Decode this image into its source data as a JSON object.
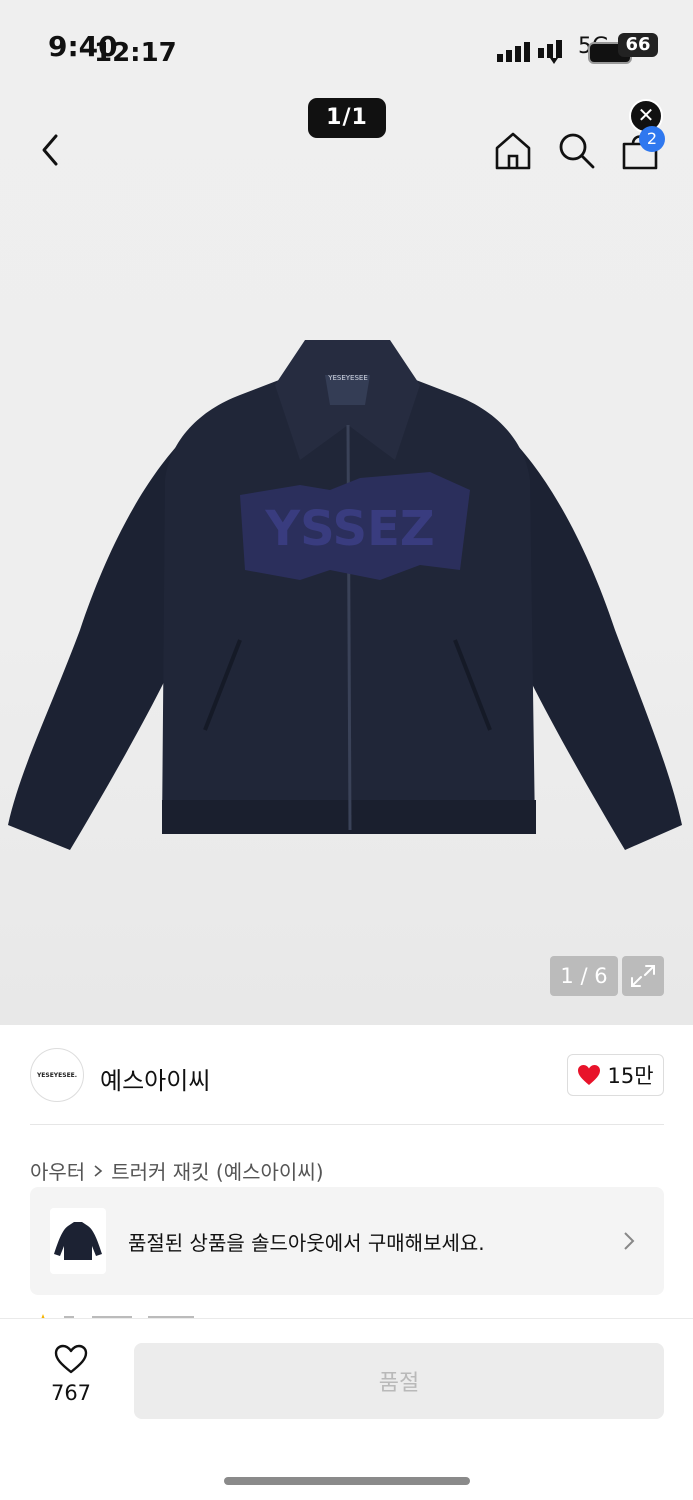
{
  "status_bar": {
    "time_primary": "9:40",
    "time_overlay": "12:17",
    "network": "5G",
    "battery": "66"
  },
  "header": {
    "pager": "1/1",
    "cart_count": "2"
  },
  "gallery": {
    "counter": "1 / 6",
    "product_logo_text": "YESEYESEE"
  },
  "brand": {
    "logo_text": "YESEYESEE.",
    "name": "예스아이씨",
    "likes": "15만"
  },
  "breadcrumb": {
    "category": "아우터",
    "product": "트러커 재킷 (예스아이씨)"
  },
  "soldout_banner": {
    "text": "품절된 상품을 솔드아웃에서 구매해보세요."
  },
  "bottom_bar": {
    "wish_count": "767",
    "buy_label": "품절"
  },
  "colors": {
    "accent_blue": "#2f78ef",
    "heart_red": "#e8132a",
    "jacket_navy": "#1c2233"
  }
}
